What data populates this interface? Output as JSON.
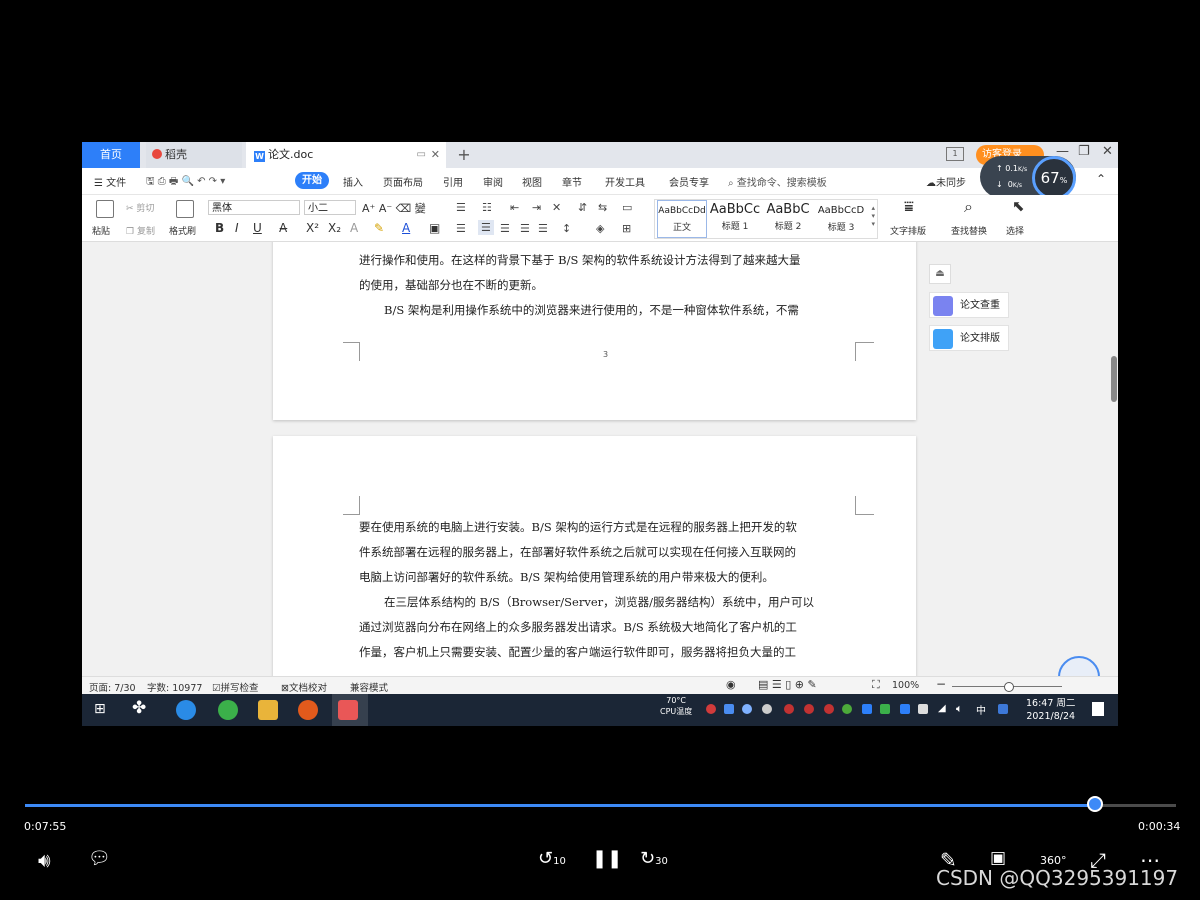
{
  "tabs": {
    "home": "首页",
    "daoke": "稻壳",
    "doc": "论文.doc",
    "add": "+"
  },
  "titlebar": {
    "login": "访客登录",
    "panel_icon": "1"
  },
  "menu": {
    "file": "文件",
    "items": [
      "开始",
      "插入",
      "页面布局",
      "引用",
      "审阅",
      "视图",
      "章节",
      "开发工具",
      "会员专享"
    ],
    "search": "查找命令、搜索模板",
    "sync": "未同步"
  },
  "netmon": {
    "up": "0.1",
    "up_unit": "K/s",
    "down": "0",
    "down_unit": "K/s",
    "percent": "67",
    "percent_unit": "%"
  },
  "ribbon": {
    "paste": "粘贴",
    "cut": "剪切",
    "copy": "复制",
    "format_painter": "格式刷",
    "font": "黑体",
    "size": "小二",
    "styles": [
      {
        "sample": "AaBbCcDd",
        "label": "正文"
      },
      {
        "sample": "AaBbCc",
        "label": "标题 1"
      },
      {
        "sample": "AaBbC",
        "label": "标题 2"
      },
      {
        "sample": "AaBbCcD",
        "label": "标题 3"
      }
    ],
    "text_layout": "文字排版",
    "find_replace": "查找替换",
    "select": "选择"
  },
  "side_panel": {
    "check": "论文查重",
    "layout": "论文排版"
  },
  "document": {
    "page1_lines": [
      "进行操作和使用。在这样的背景下基于 B/S 架构的软件系统设计方法得到了越来越大量",
      "的使用，基础部分也在不断的更新。",
      "B/S 架构是利用操作系统中的浏览器来进行使用的，不是一种窗体软件系统，不需"
    ],
    "page_number": "3",
    "page2_lines": [
      "要在使用系统的电脑上进行安装。B/S 架构的运行方式是在远程的服务器上把开发的软",
      "件系统部署在远程的服务器上，在部署好软件系统之后就可以实现在任何接入互联网的",
      "电脑上访问部署好的软件系统。B/S 架构给使用管理系统的用户带来极大的便利。",
      "在三层体系结构的 B/S（Browser/Server，浏览器/服务器结构）系统中，用户可以",
      "通过浏览器向分布在网络上的众多服务器发出请求。B/S 系统极大地简化了客户机的工",
      "作量，客户机上只需要安装、配置少量的客户端运行软件即可，服务器将担负大量的工"
    ]
  },
  "statusbar": {
    "page": "页面: 7/30",
    "words": "字数: 10977",
    "spell": "拼写检查",
    "proof": "文档校对",
    "compat": "兼容模式",
    "zoom": "100%"
  },
  "taskbar": {
    "cpu_temp": "70°C",
    "cpu_label": "CPU温度",
    "time": "16:47 周二",
    "date": "2021/8/24",
    "ime": "中"
  },
  "player": {
    "elapsed": "0:07:55",
    "remaining": "0:00:34",
    "progress": 0.93,
    "rewind": "10",
    "forward": "30",
    "quality": "360°"
  },
  "watermark": "CSDN @QQ3295391197"
}
